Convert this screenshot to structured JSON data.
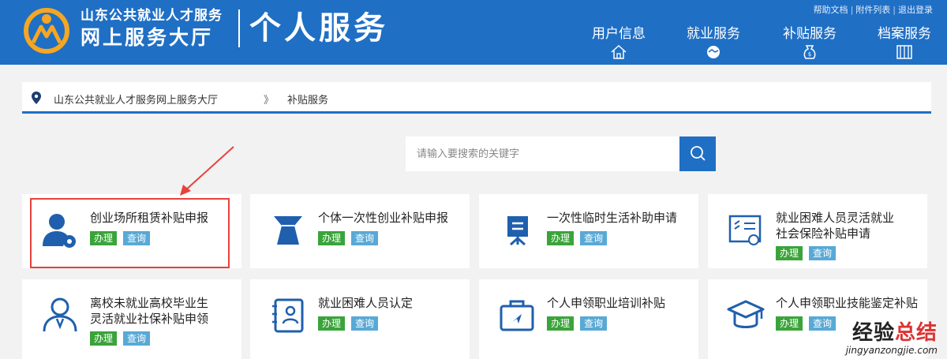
{
  "header": {
    "org_line1": "山东公共就业人才服务",
    "org_line2": "网上服务大厅",
    "section_title": "个人服务",
    "top_links": [
      "帮助文档",
      "附件列表",
      "退出登录"
    ],
    "nav": [
      {
        "label": "用户信息",
        "icon": "home-icon"
      },
      {
        "label": "就业服务",
        "icon": "handshake-icon"
      },
      {
        "label": "补贴服务",
        "icon": "money-bag-icon"
      },
      {
        "label": "档案服务",
        "icon": "archive-icon"
      }
    ],
    "colors": {
      "primary": "#1f6fc5",
      "logo_orange": "#f5a623"
    }
  },
  "breadcrumb": {
    "home": "山东公共就业人才服务网上服务大厅",
    "separator": "》",
    "current": "补贴服务"
  },
  "search": {
    "placeholder": "请输入要搜索的关键字"
  },
  "buttons": {
    "handle": "办理",
    "query": "查询"
  },
  "services": [
    {
      "title_line1": "创业场所租赁补贴申报",
      "title_line2": "",
      "icon": "user-wrench-icon"
    },
    {
      "title_line1": "个体一次性创业补贴申报",
      "title_line2": "",
      "icon": "money-bag-icon"
    },
    {
      "title_line1": "一次性临时生活补助申请",
      "title_line2": "",
      "icon": "easel-icon"
    },
    {
      "title_line1": "就业困难人员灵活就业",
      "title_line2": "社会保险补贴申请",
      "icon": "certificate-icon"
    },
    {
      "title_line1": "离校未就业高校毕业生",
      "title_line2": "灵活就业社保补贴申领",
      "icon": "graduate-user-icon"
    },
    {
      "title_line1": "就业困难人员认定",
      "title_line2": "",
      "icon": "id-card-icon"
    },
    {
      "title_line1": "个人申领职业培训补贴",
      "title_line2": "",
      "icon": "briefcase-icon"
    },
    {
      "title_line1": "个人申领职业技能鉴定补贴",
      "title_line2": "",
      "icon": "mortarboard-icon"
    }
  ],
  "watermark": {
    "line1": "经验",
    "line1_red": "总结",
    "line2": "jingyanzongjie.com"
  }
}
